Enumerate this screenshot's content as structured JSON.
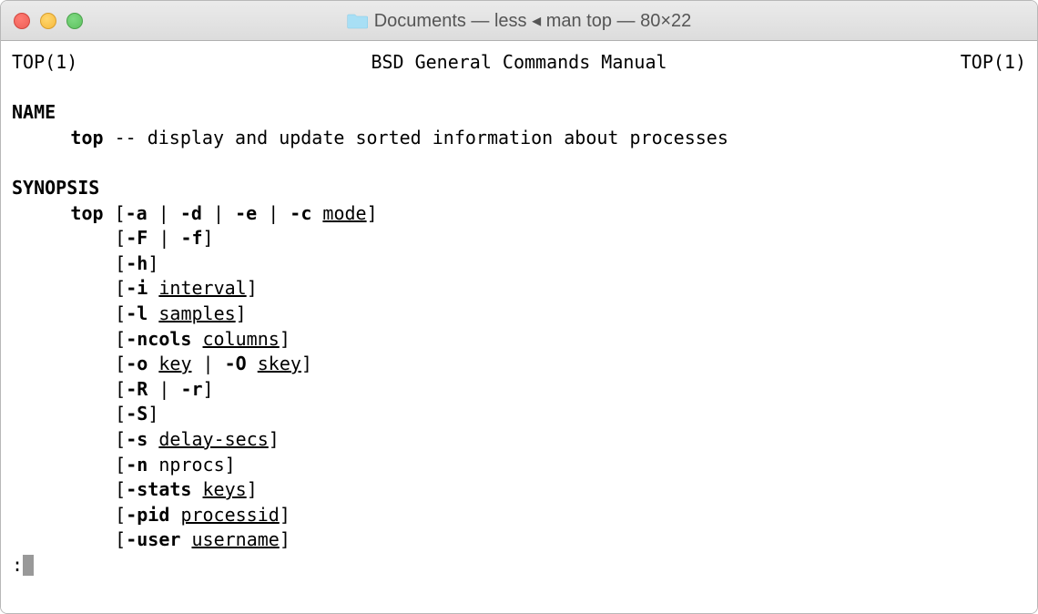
{
  "window": {
    "title": "Documents — less ◂ man top — 80×22"
  },
  "man": {
    "header_left": "TOP(1)",
    "header_center": "BSD General Commands Manual",
    "header_right": "TOP(1)",
    "section_name": "NAME",
    "name_cmd": "top",
    "name_desc": " -- display and update sorted information about processes",
    "section_synopsis": "SYNOPSIS",
    "syn_cmd": "top",
    "syn": {
      "l0": {
        "open": " [",
        "a": "-a",
        "p1": " | ",
        "d": "-d",
        "p2": " | ",
        "e": "-e",
        "p3": " | ",
        "c": "-c",
        "sp": " ",
        "mode": "mode",
        "close": "]"
      },
      "l1": {
        "open": "[",
        "F": "-F",
        "p1": " | ",
        "f": "-f",
        "close": "]"
      },
      "l2": {
        "open": "[",
        "h": "-h",
        "close": "]"
      },
      "l3": {
        "open": "[",
        "i": "-i",
        "sp": " ",
        "interval": "interval",
        "close": "]"
      },
      "l4": {
        "open": "[",
        "l": "-l",
        "sp": " ",
        "samples": "samples",
        "close": "]"
      },
      "l5": {
        "open": "[",
        "ncols": "-ncols",
        "sp": " ",
        "columns": "columns",
        "close": "]"
      },
      "l6": {
        "open": "[",
        "o": "-o",
        "sp1": " ",
        "key": "key",
        "p1": " | ",
        "O": "-O",
        "sp2": " ",
        "skey": "skey",
        "close": "]"
      },
      "l7": {
        "open": "[",
        "R": "-R",
        "p1": " | ",
        "r": "-r",
        "close": "]"
      },
      "l8": {
        "open": "[",
        "S": "-S",
        "close": "]"
      },
      "l9": {
        "open": "[",
        "s": "-s",
        "sp": " ",
        "delay": "delay-secs",
        "close": "]"
      },
      "l10": {
        "open": "[",
        "n": "-n",
        "sp": " ",
        "nprocs": "nprocs",
        "close": "]"
      },
      "l11": {
        "open": "[",
        "stats": "-stats",
        "sp": " ",
        "keys": "keys",
        "close": "]"
      },
      "l12": {
        "open": "[",
        "pid": "-pid",
        "sp": " ",
        "processid": "processid",
        "close": "]"
      },
      "l13": {
        "open": "[",
        "user": "-user",
        "sp": " ",
        "username": "username",
        "close": "]"
      }
    },
    "prompt": ":"
  }
}
